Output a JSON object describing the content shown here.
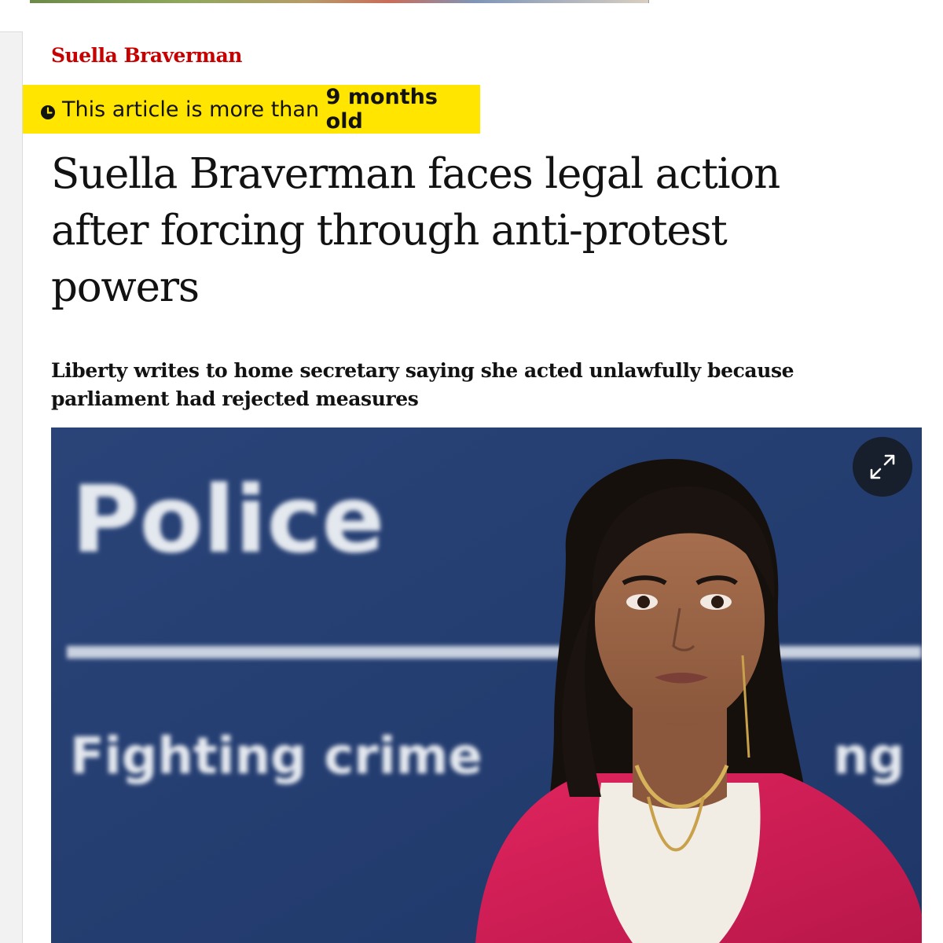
{
  "article": {
    "section_label": "Suella Braverman",
    "age_notice": {
      "prefix": "This article is more than ",
      "age": "9 months old",
      "icon": "clock-icon",
      "background": "#ffe500"
    },
    "headline": "Suella Braverman faces legal action after forcing through anti-protest powers",
    "standfirst": "Liberty writes to home secretary saying she acted unlawfully because parliament had rejected measures",
    "image": {
      "sign_title": "Police",
      "sign_subtitle": "Fighting crime",
      "sign_subtitle_tail": "ng",
      "expand_icon": "expand-arrows-icon"
    }
  },
  "colors": {
    "section_red": "#c70000",
    "badge_yellow": "#ffe500",
    "text": "#121212",
    "sign_blue": "#253f72"
  }
}
